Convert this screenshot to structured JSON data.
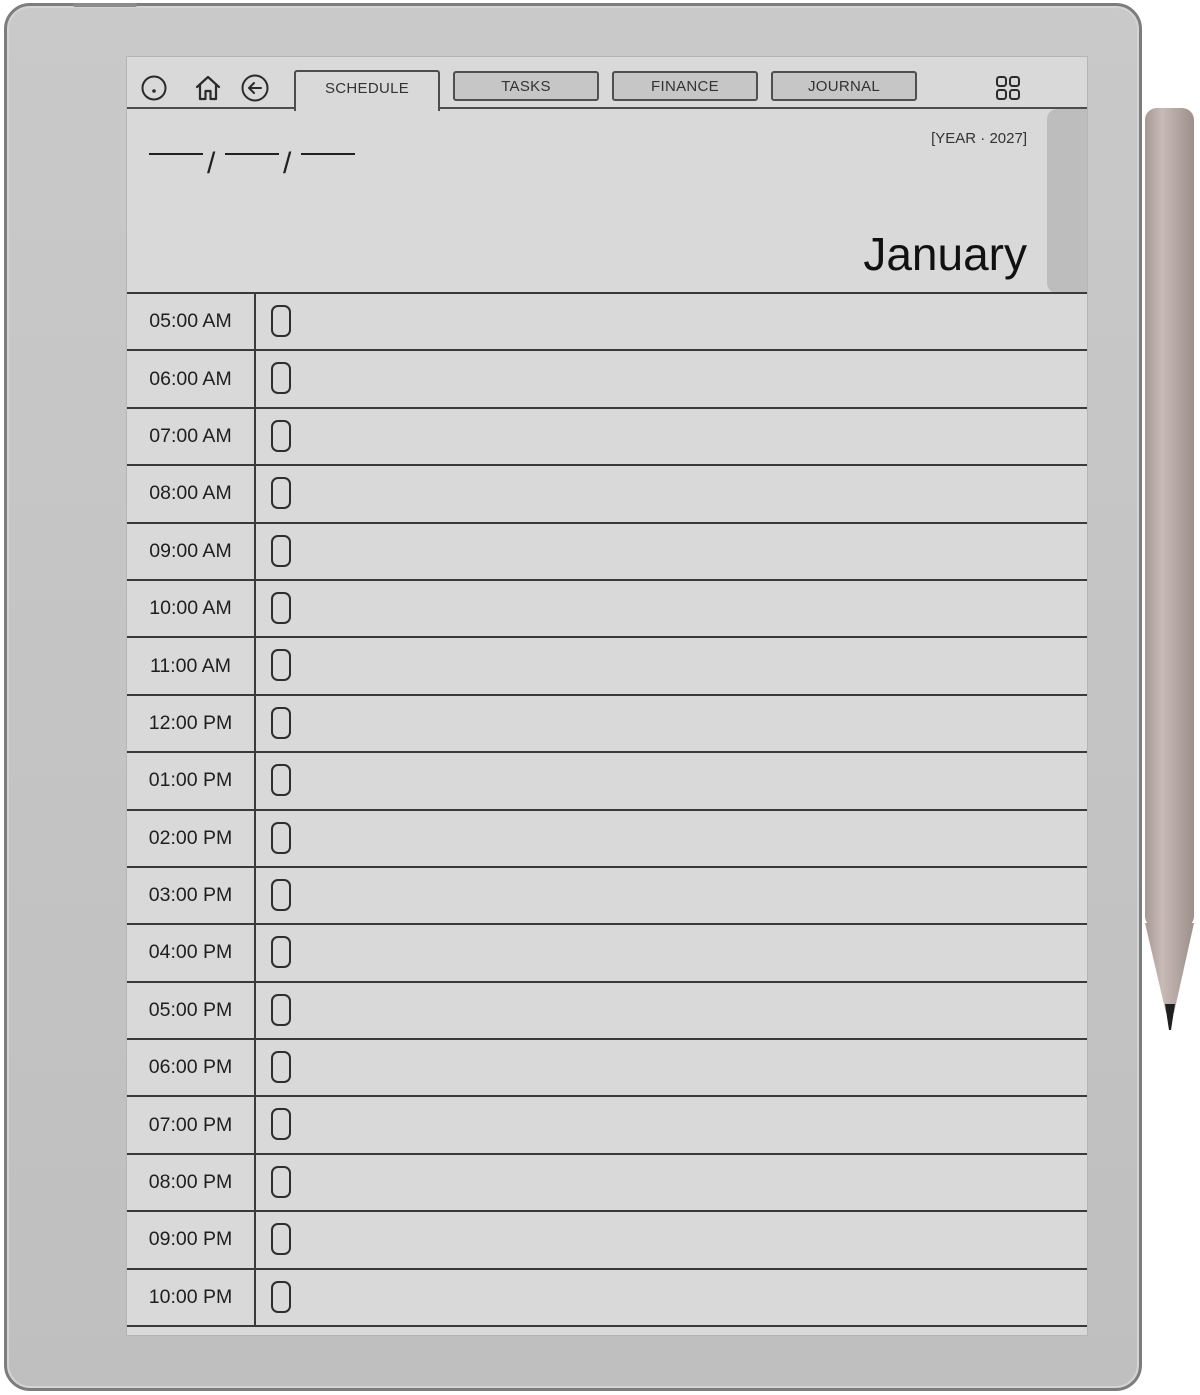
{
  "tabs": [
    {
      "label": "SCHEDULE",
      "active": true
    },
    {
      "label": "TASKS",
      "active": false
    },
    {
      "label": "FINANCE",
      "active": false
    },
    {
      "label": "JOURNAL",
      "active": false
    }
  ],
  "toolbar_icons": [
    "circle-dot-icon",
    "home-icon",
    "back-arrow-icon",
    "grid-icon"
  ],
  "header": {
    "date_separator": "/",
    "year_label": "[YEAR · 2027]",
    "month": "January"
  },
  "schedule": {
    "times": [
      "05:00 AM",
      "06:00 AM",
      "07:00 AM",
      "08:00 AM",
      "09:00 AM",
      "10:00 AM",
      "11:00 AM",
      "12:00 PM",
      "01:00 PM",
      "02:00 PM",
      "03:00 PM",
      "04:00 PM",
      "05:00 PM",
      "06:00 PM",
      "07:00 PM",
      "08:00 PM",
      "09:00 PM",
      "10:00 PM"
    ]
  },
  "colors": {
    "screen": "#d9d9d9",
    "device_frame": "#c4c4c4",
    "lines": "#3a3a3a",
    "pen": "#b8aaa6"
  }
}
